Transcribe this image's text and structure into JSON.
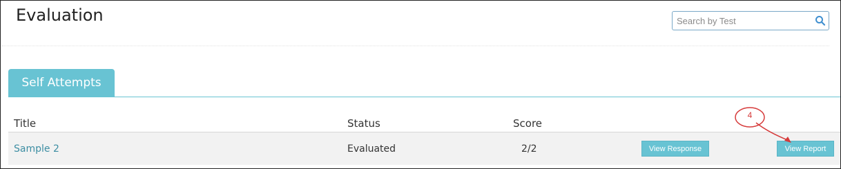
{
  "page": {
    "title": "Evaluation"
  },
  "search": {
    "placeholder": "Search by Test"
  },
  "tabs": [
    {
      "label": "Self Attempts"
    }
  ],
  "table": {
    "headers": {
      "title": "Title",
      "status": "Status",
      "score": "Score"
    },
    "rows": [
      {
        "title": "Sample 2",
        "status": "Evaluated",
        "score": "2/2",
        "view_response_label": "View Response",
        "view_report_label": "View Report"
      }
    ]
  },
  "annotation": {
    "callout_number": "4"
  },
  "colors": {
    "accent": "#68c3d3",
    "link": "#3d8ea3",
    "callout": "#d63a3a",
    "row_bg": "#f2f2f2"
  },
  "icons": {
    "search": "search-icon"
  }
}
